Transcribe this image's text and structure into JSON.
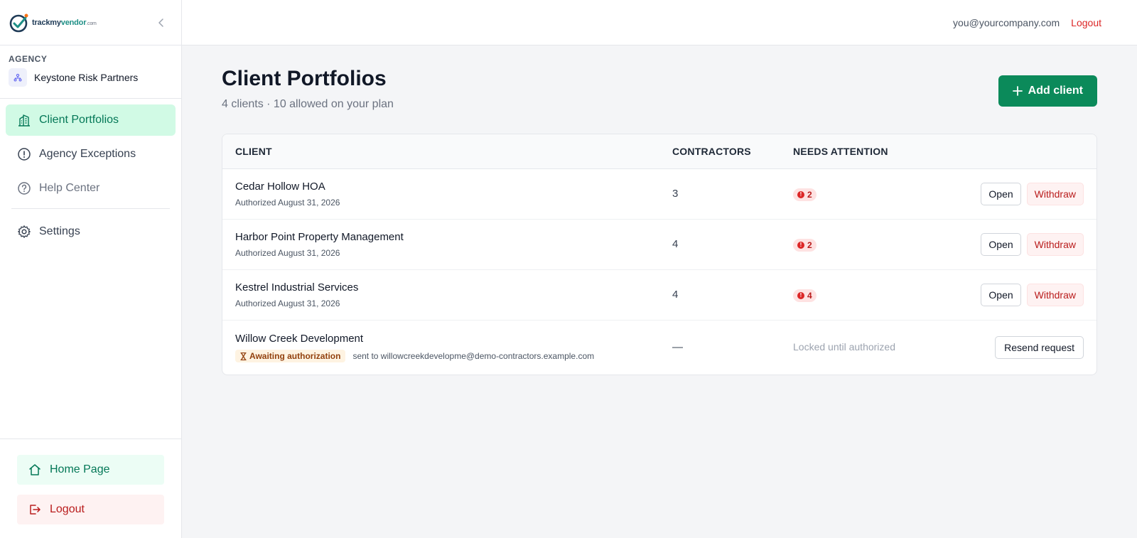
{
  "brand": {
    "name_prefix": "trackmy",
    "name_highlight": "vendor",
    "name_suffix": ".com",
    "collapse_icon": "chevron-left-icon"
  },
  "sidebar": {
    "agency_label": "AGENCY",
    "agency_name": "Keystone Risk Partners",
    "items": [
      {
        "label": "Client Portfolios",
        "icon": "buildings-icon",
        "active": true
      },
      {
        "label": "Agency Exceptions",
        "icon": "alert-circle-icon",
        "active": false
      },
      {
        "label": "Help Center",
        "icon": "help-circle-icon",
        "active": false
      },
      {
        "label": "Settings",
        "icon": "gear-icon",
        "active": false
      }
    ],
    "home_label": "Home Page",
    "logout_label": "Logout"
  },
  "topbar": {
    "user_email": "you@yourcompany.com",
    "logout_label": "Logout"
  },
  "page": {
    "title": "Client Portfolios",
    "subtitle": "4 clients · 10 allowed on your plan",
    "add_button": "Add client"
  },
  "table": {
    "headers": {
      "client": "CLIENT",
      "contractors": "CONTRACTORS",
      "attention": "NEEDS ATTENTION"
    },
    "rows": [
      {
        "name": "Cedar Hollow HOA",
        "meta": "Authorized August 31, 2026",
        "contractors": "3",
        "attention": "2",
        "open": "Open",
        "withdraw": "Withdraw"
      },
      {
        "name": "Harbor Point Property Management",
        "meta": "Authorized August 31, 2026",
        "contractors": "4",
        "attention": "2",
        "open": "Open",
        "withdraw": "Withdraw"
      },
      {
        "name": "Kestrel Industrial Services",
        "meta": "Authorized August 31, 2026",
        "contractors": "4",
        "attention": "4",
        "open": "Open",
        "withdraw": "Withdraw"
      }
    ],
    "pending_row": {
      "name": "Willow Creek Development",
      "status_badge": "Awaiting authorization",
      "sent_to": "sent to willowcreekdevelopme@demo-contractors.example.com",
      "contractors": "—",
      "attention": "Locked until authorized",
      "resend": "Resend request"
    }
  },
  "colors": {
    "primary": "#0b8a5a",
    "active_nav_bg": "#d1fae5",
    "danger": "#dc2626"
  }
}
